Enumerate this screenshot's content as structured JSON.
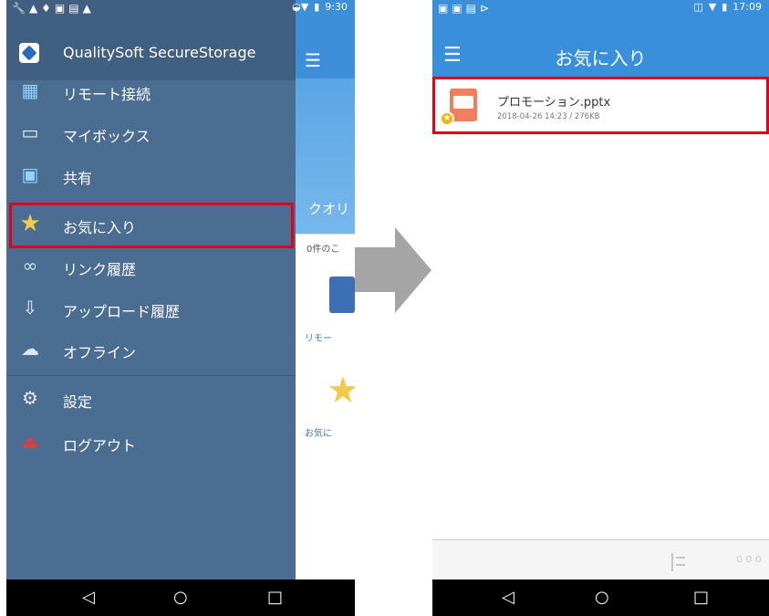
{
  "left_phone": {
    "status": {
      "time": "9:30"
    },
    "background_app": {
      "banner_text": "クオリ",
      "count_text": "0件のこ",
      "remote_label": "リモー",
      "fav_label": "お気に"
    },
    "drawer": {
      "app_name": "QualitySoft SecureStorage",
      "items": [
        {
          "label": "リモート接続",
          "icon": "remote-desktop-icon"
        },
        {
          "label": "マイボックス",
          "icon": "box-icon"
        },
        {
          "label": "共有",
          "icon": "shared-icon"
        },
        {
          "label": "お気に入り",
          "icon": "star-icon"
        },
        {
          "label": "リンク履歴",
          "icon": "link-icon"
        },
        {
          "label": "アップロード履歴",
          "icon": "upload-history-icon"
        },
        {
          "label": "オフライン",
          "icon": "cloud-icon"
        },
        {
          "label": "設定",
          "icon": "gear-icon"
        },
        {
          "label": "ログアウト",
          "icon": "logout-icon"
        }
      ]
    }
  },
  "right_phone": {
    "status": {
      "time": "17:09"
    },
    "header": {
      "title": "お気に入り"
    },
    "files": [
      {
        "name": "プロモーション.pptx",
        "meta": "2018-04-26 14:23 / 276KB",
        "icon": "pptx-file-icon",
        "favorite": true
      }
    ],
    "toolbar": {
      "more_label": "ooo"
    }
  },
  "colors": {
    "drawer": "#4a6d91",
    "header": "#3a8fdb",
    "highlight": "#e0001b",
    "arrow": "#a5a5a5"
  }
}
